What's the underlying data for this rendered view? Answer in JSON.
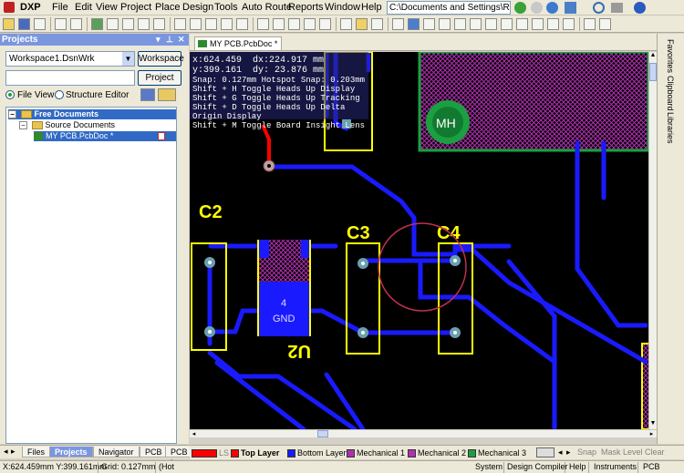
{
  "app": {
    "logo": "DXP"
  },
  "menu": [
    "File",
    "Edit",
    "View",
    "Project",
    "Place",
    "Design",
    "Tools",
    "Auto Route",
    "Reports",
    "Window",
    "Help"
  ],
  "path_field": "C:\\Documents and Settings\\ROBO\\Loca",
  "projects_panel": {
    "title": "Projects",
    "workspace_value": "Workspace1.DsnWrk",
    "workspace_button": "Workspace",
    "project_button": "Project",
    "view_options": [
      {
        "label": "File View",
        "selected": true
      },
      {
        "label": "Structure Editor",
        "selected": false
      }
    ],
    "tree": {
      "root": "Free Documents",
      "folder": "Source Documents",
      "file": "MY PCB.PcbDoc *"
    }
  },
  "left_tabs": [
    "Files",
    "Projects",
    "Navigator",
    "PCB",
    "PCB I"
  ],
  "active_left_tab": "Projects",
  "document_tab": "MY PCB.PcbDoc *",
  "right_rail": [
    "Favorites",
    "Clipboard",
    "Libraries"
  ],
  "hud": {
    "x": "x:624.459",
    "dx": "dx:224.917 mm",
    "y": "y:399.161",
    "dy": "dy: 23.876  mm",
    "snap": "Snap: 0.127mm Hotspot Snap: 0.203mm",
    "lines": [
      "Shift + H  Toggle Heads Up Display",
      "Shift + G  Toggle Heads Up Tracking",
      "Shift + D  Toggle Heads Up Delta Origin Display",
      "Shift + M  Toggle Board Insight Lens"
    ]
  },
  "pcb": {
    "labels": {
      "c2": "C2",
      "c3": "C3",
      "c4": "C4",
      "u2": "U2",
      "mh": "MH",
      "pad_num": "4",
      "pad_net": "GND"
    },
    "colors": {
      "background": "#000000",
      "top_layer": "#ff0000",
      "bottom_layer": "#1a1aff",
      "overlay": "#ffff00",
      "keepout": "#b030b0",
      "mh": "#1aa040"
    }
  },
  "layer_tabs": [
    {
      "label": "LS",
      "color": "#ff0000"
    },
    {
      "label": "Top Layer",
      "color": "#ff0000"
    },
    {
      "label": "Bottom Layer",
      "color": "#1a1aff"
    },
    {
      "label": "Mechanical 1",
      "color": "#b030b0"
    },
    {
      "label": "Mechanical 2",
      "color": "#b030b0"
    },
    {
      "label": "Mechanical 3",
      "color": "#1aa040"
    }
  ],
  "layer_actions": [
    "Snap",
    "Mask Level",
    "Clear"
  ],
  "status": {
    "coords": "X:624.459mm Y:399.161mm",
    "grid": "Grid: 0.127mm",
    "hot": "(Hot",
    "right": [
      "System",
      "Design Compiler",
      "Help",
      "Instruments",
      "PCB"
    ]
  }
}
